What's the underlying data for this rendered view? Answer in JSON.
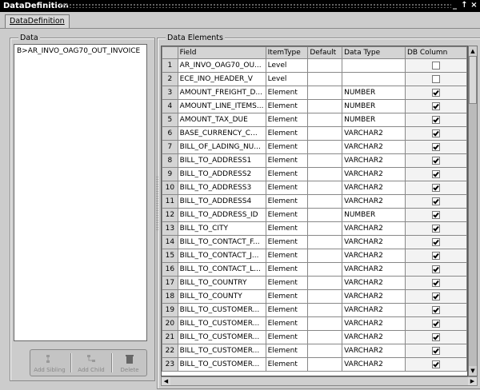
{
  "window": {
    "title": "DataDefinition",
    "tab_label": "DataDefinition"
  },
  "data_panel": {
    "legend": "Data",
    "tree_root": "AR_INVO_OAG70_OUT_INVOICE",
    "tree_prefix": "B>"
  },
  "toolbar": {
    "add_sibling": "Add Sibling",
    "add_child": "Add Child",
    "delete": "Delete"
  },
  "elements_panel": {
    "legend": "Data Elements",
    "columns": [
      "Field",
      "ItemType",
      "Default",
      "Data Type",
      "DB Column"
    ],
    "rows": [
      {
        "n": "1",
        "field": "AR_INVO_OAG70_OU...",
        "type": "Level",
        "default": "",
        "dtype": "",
        "db": false
      },
      {
        "n": "2",
        "field": "ECE_INO_HEADER_V",
        "type": "Level",
        "default": "",
        "dtype": "",
        "db": false
      },
      {
        "n": "3",
        "field": "AMOUNT_FREIGHT_D...",
        "type": "Element",
        "default": "",
        "dtype": "NUMBER",
        "db": true
      },
      {
        "n": "4",
        "field": "AMOUNT_LINE_ITEMS...",
        "type": "Element",
        "default": "",
        "dtype": "NUMBER",
        "db": true
      },
      {
        "n": "5",
        "field": "AMOUNT_TAX_DUE",
        "type": "Element",
        "default": "",
        "dtype": "NUMBER",
        "db": true
      },
      {
        "n": "6",
        "field": "BASE_CURRENCY_C...",
        "type": "Element",
        "default": "",
        "dtype": "VARCHAR2",
        "db": true
      },
      {
        "n": "7",
        "field": "BILL_OF_LADING_NU...",
        "type": "Element",
        "default": "",
        "dtype": "VARCHAR2",
        "db": true
      },
      {
        "n": "8",
        "field": "BILL_TO_ADDRESS1",
        "type": "Element",
        "default": "",
        "dtype": "VARCHAR2",
        "db": true
      },
      {
        "n": "9",
        "field": "BILL_TO_ADDRESS2",
        "type": "Element",
        "default": "",
        "dtype": "VARCHAR2",
        "db": true
      },
      {
        "n": "10",
        "field": "BILL_TO_ADDRESS3",
        "type": "Element",
        "default": "",
        "dtype": "VARCHAR2",
        "db": true
      },
      {
        "n": "11",
        "field": "BILL_TO_ADDRESS4",
        "type": "Element",
        "default": "",
        "dtype": "VARCHAR2",
        "db": true
      },
      {
        "n": "12",
        "field": "BILL_TO_ADDRESS_ID",
        "type": "Element",
        "default": "",
        "dtype": "NUMBER",
        "db": true
      },
      {
        "n": "13",
        "field": "BILL_TO_CITY",
        "type": "Element",
        "default": "",
        "dtype": "VARCHAR2",
        "db": true
      },
      {
        "n": "14",
        "field": "BILL_TO_CONTACT_F...",
        "type": "Element",
        "default": "",
        "dtype": "VARCHAR2",
        "db": true
      },
      {
        "n": "15",
        "field": "BILL_TO_CONTACT_J...",
        "type": "Element",
        "default": "",
        "dtype": "VARCHAR2",
        "db": true
      },
      {
        "n": "16",
        "field": "BILL_TO_CONTACT_L...",
        "type": "Element",
        "default": "",
        "dtype": "VARCHAR2",
        "db": true
      },
      {
        "n": "17",
        "field": "BILL_TO_COUNTRY",
        "type": "Element",
        "default": "",
        "dtype": "VARCHAR2",
        "db": true
      },
      {
        "n": "18",
        "field": "BILL_TO_COUNTY",
        "type": "Element",
        "default": "",
        "dtype": "VARCHAR2",
        "db": true
      },
      {
        "n": "19",
        "field": "BILL_TO_CUSTOMER...",
        "type": "Element",
        "default": "",
        "dtype": "VARCHAR2",
        "db": true
      },
      {
        "n": "20",
        "field": "BILL_TO_CUSTOMER...",
        "type": "Element",
        "default": "",
        "dtype": "VARCHAR2",
        "db": true
      },
      {
        "n": "21",
        "field": "BILL_TO_CUSTOMER...",
        "type": "Element",
        "default": "",
        "dtype": "VARCHAR2",
        "db": true
      },
      {
        "n": "22",
        "field": "BILL_TO_CUSTOMER...",
        "type": "Element",
        "default": "",
        "dtype": "VARCHAR2",
        "db": true
      },
      {
        "n": "23",
        "field": "BILL_TO_CUSTOMER...",
        "type": "Element",
        "default": "",
        "dtype": "VARCHAR2",
        "db": true
      }
    ]
  },
  "icons": {
    "minimize": "underscore",
    "maximize": "up-arrow",
    "close": "x"
  }
}
